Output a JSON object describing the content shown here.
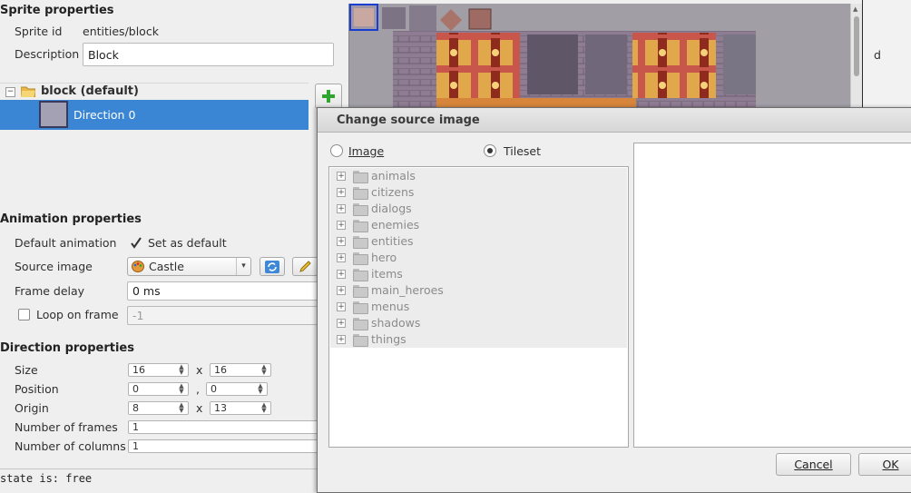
{
  "sprite": {
    "section_title": "Sprite properties",
    "sprite_id_label": "Sprite id",
    "sprite_id_value": "entities/block",
    "description_label": "Description",
    "description_value": "Block"
  },
  "tree": {
    "animation_name": "block (default)",
    "direction_label": "Direction 0"
  },
  "animation": {
    "section_title": "Animation properties",
    "default_label": "Default animation",
    "default_checkbox_label": "Set as default",
    "source_label": "Source image",
    "source_value": "Castle",
    "frame_delay_label": "Frame delay",
    "frame_delay_value": "0 ms",
    "loop_label": "Loop on frame",
    "loop_value": "-1"
  },
  "direction": {
    "section_title": "Direction properties",
    "size_label": "Size",
    "size_w": "16",
    "size_h": "16",
    "size_sep": "x",
    "position_label": "Position",
    "pos_x": "0",
    "pos_y": "0",
    "pos_sep": ",",
    "origin_label": "Origin",
    "origin_x": "8",
    "origin_y": "13",
    "origin_sep": "x",
    "frames_label": "Number of frames",
    "frames_value": "1",
    "columns_label": "Number of columns",
    "columns_value": "1"
  },
  "status_text": "state is: free",
  "right_strip_text": "d",
  "dialog": {
    "title": "Change source image",
    "radio_image": "Image",
    "radio_tileset": "Tileset",
    "selected": "Tileset",
    "folders": [
      "animals",
      "citizens",
      "dialogs",
      "enemies",
      "entities",
      "hero",
      "items",
      "main_heroes",
      "menus",
      "shadows",
      "things"
    ],
    "cancel_label": "Cancel",
    "ok_label": "OK"
  },
  "colors": {
    "selection": "#3b86d4",
    "add_icon": "#2ea52e",
    "tileset_bg": "#a19ea6"
  }
}
